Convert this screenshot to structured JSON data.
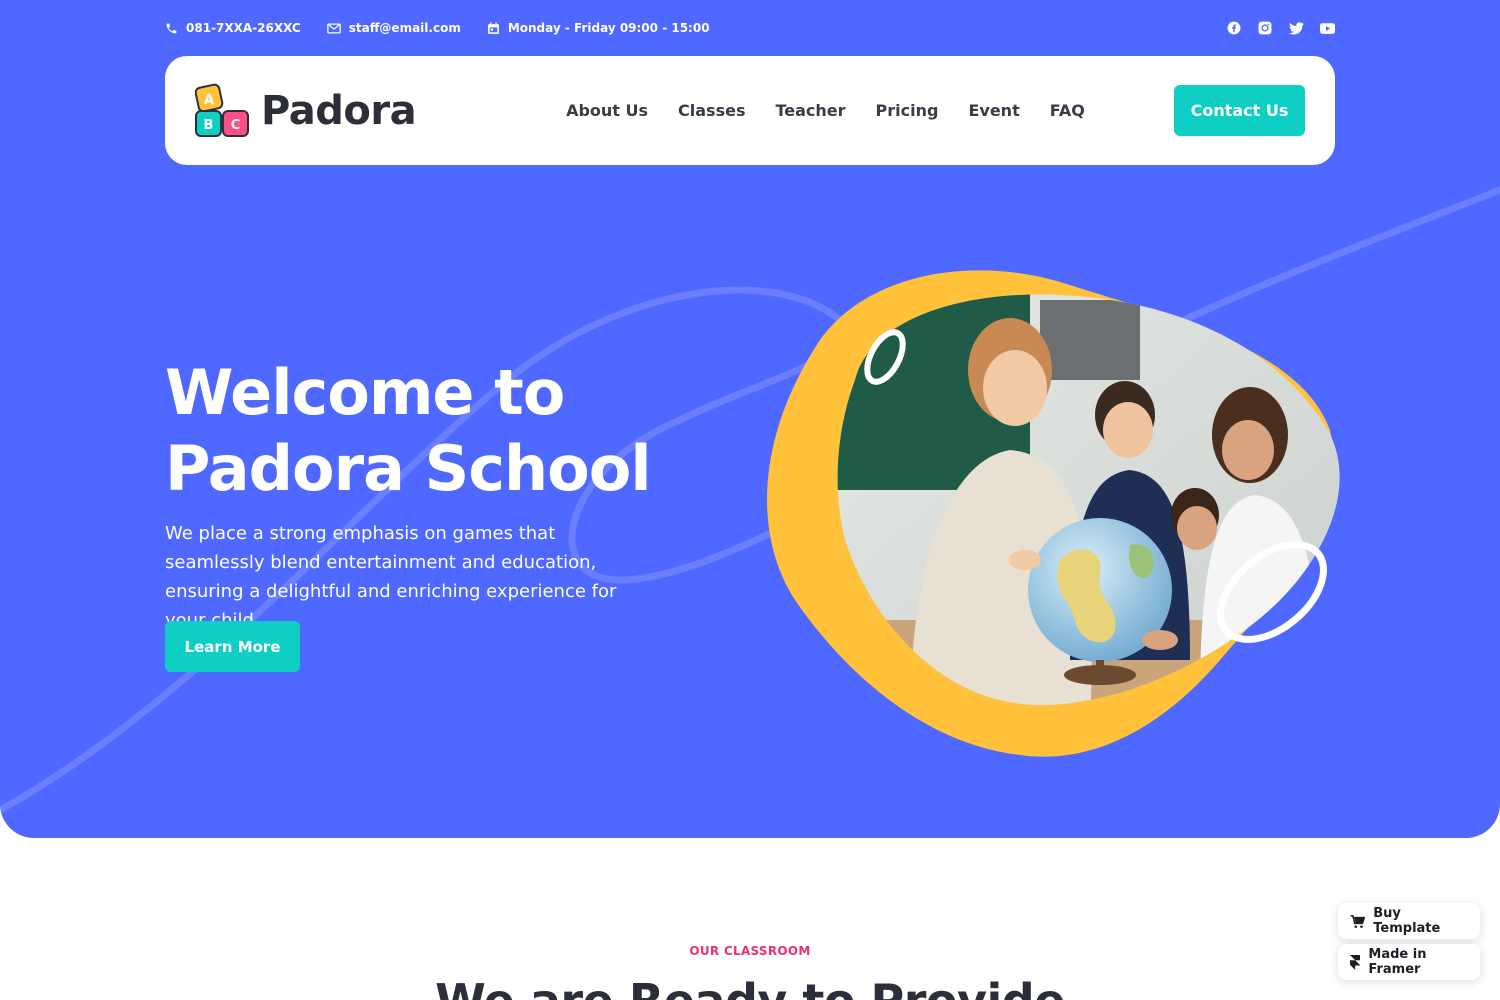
{
  "topbar": {
    "phone": "081-7XXA-26XXC",
    "email": "staff@email.com",
    "hours": "Monday - Friday 09:00 - 15:00",
    "socials": [
      {
        "name": "facebook-icon"
      },
      {
        "name": "instagram-icon"
      },
      {
        "name": "twitter-icon"
      },
      {
        "name": "youtube-icon"
      }
    ]
  },
  "navbar": {
    "brand": "Padora",
    "logo_letters": [
      "A",
      "B",
      "C"
    ],
    "links": [
      "About Us",
      "Classes",
      "Teacher",
      "Pricing",
      "Event",
      "FAQ"
    ],
    "cta_label": "Contact Us"
  },
  "hero": {
    "title_line1": "Welcome to",
    "title_line2": "Padora School",
    "subtitle": "We place a strong emphasis on games that seamlessly blend entertainment and education, ensuring a delightful and enriching experience for your child.",
    "button_label": "Learn More"
  },
  "classroom": {
    "eyebrow": "OUR CLASSROOM",
    "title": "We are Ready to Provide"
  },
  "floating": {
    "buy_label": "Buy Template",
    "framer_label": "Made in Framer"
  },
  "colors": {
    "hero_bg": "#4f68ff",
    "accent_teal": "#0fcec4",
    "blob_yellow": "#ffc23a",
    "eyebrow_pink": "#e8336d"
  }
}
